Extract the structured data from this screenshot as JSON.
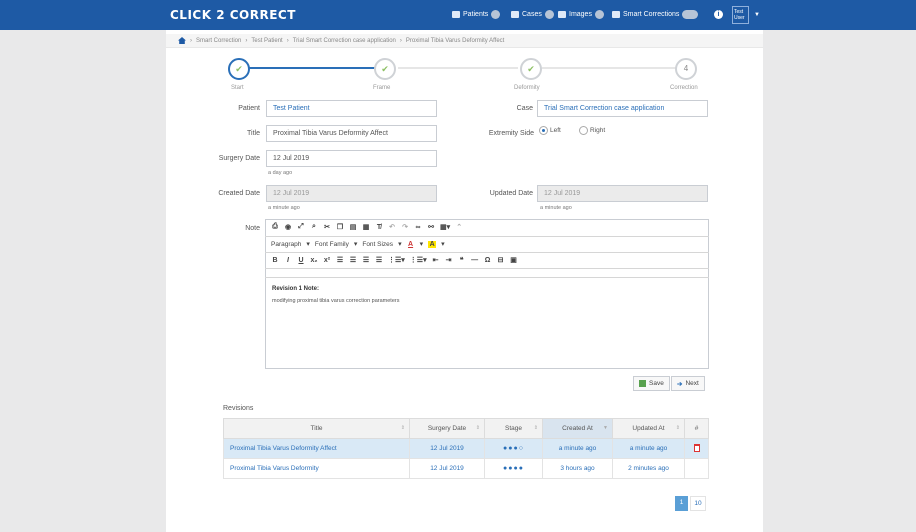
{
  "app": {
    "logo": "CLICK 2 CORRECT"
  },
  "nav": {
    "items": [
      {
        "label": "Patients",
        "icon": "users-icon"
      },
      {
        "label": "Cases",
        "icon": "briefcase-icon"
      },
      {
        "label": "Images",
        "icon": "image-icon"
      },
      {
        "label": "Smart Corrections",
        "icon": "chart-icon"
      }
    ],
    "info_icon": "i",
    "user_label": "Test User"
  },
  "breadcrumb": {
    "items": [
      "Smart Correction",
      "Test Patient",
      "Trial Smart Correction case application",
      "Proximal Tibia Varus Deformity Affect"
    ]
  },
  "steps": [
    {
      "label": "Start",
      "mark": "✔",
      "state": "active"
    },
    {
      "label": "Frame",
      "mark": "✔",
      "state": "done"
    },
    {
      "label": "Deformity",
      "mark": "✔",
      "state": "done"
    },
    {
      "label": "Correction",
      "mark": "4",
      "state": "pending"
    }
  ],
  "form": {
    "patient_label": "Patient",
    "patient_value": "Test Patient",
    "case_label": "Case",
    "case_value": "Trial Smart Correction case application",
    "title_label": "Title",
    "title_value": "Proximal Tibia Varus Deformity Affect",
    "extremity_label": "Extremity Side",
    "side_left": "Left",
    "side_right": "Right",
    "surgery_label": "Surgery Date",
    "surgery_value": "12 Jul 2019",
    "surgery_hint": "a day ago",
    "created_label": "Created Date",
    "created_value": "12 Jul 2019",
    "created_hint": "a minute ago",
    "updated_label": "Updated Date",
    "updated_value": "12 Jul 2019",
    "updated_hint": "a minute ago",
    "note_label": "Note"
  },
  "editor": {
    "row2": {
      "paragraph": "Paragraph",
      "font_family": "Font Family",
      "font_sizes": "Font Sizes"
    },
    "content_title": "Revision 1 Note:",
    "content_body": "modifying proximal tibia varus correction parameters"
  },
  "buttons": {
    "save": "Save",
    "next": "Next"
  },
  "revisions": {
    "title": "Revisions",
    "columns": [
      "Title",
      "Surgery Date",
      "Stage",
      "Created At",
      "Updated At",
      "#"
    ],
    "rows": [
      {
        "title": "Proximal Tibia Varus Deformity Affect",
        "surgery": "12 Jul 2019",
        "stage": "●●●○",
        "created": "a minute ago",
        "updated": "a minute ago",
        "highlight": true
      },
      {
        "title": "Proximal Tibia Varus Deformity",
        "surgery": "12 Jul 2019",
        "stage": "●●●●",
        "created": "3 hours ago",
        "updated": "2 minutes ago",
        "highlight": false
      }
    ]
  },
  "pagination": {
    "current": "1",
    "next": "10"
  }
}
